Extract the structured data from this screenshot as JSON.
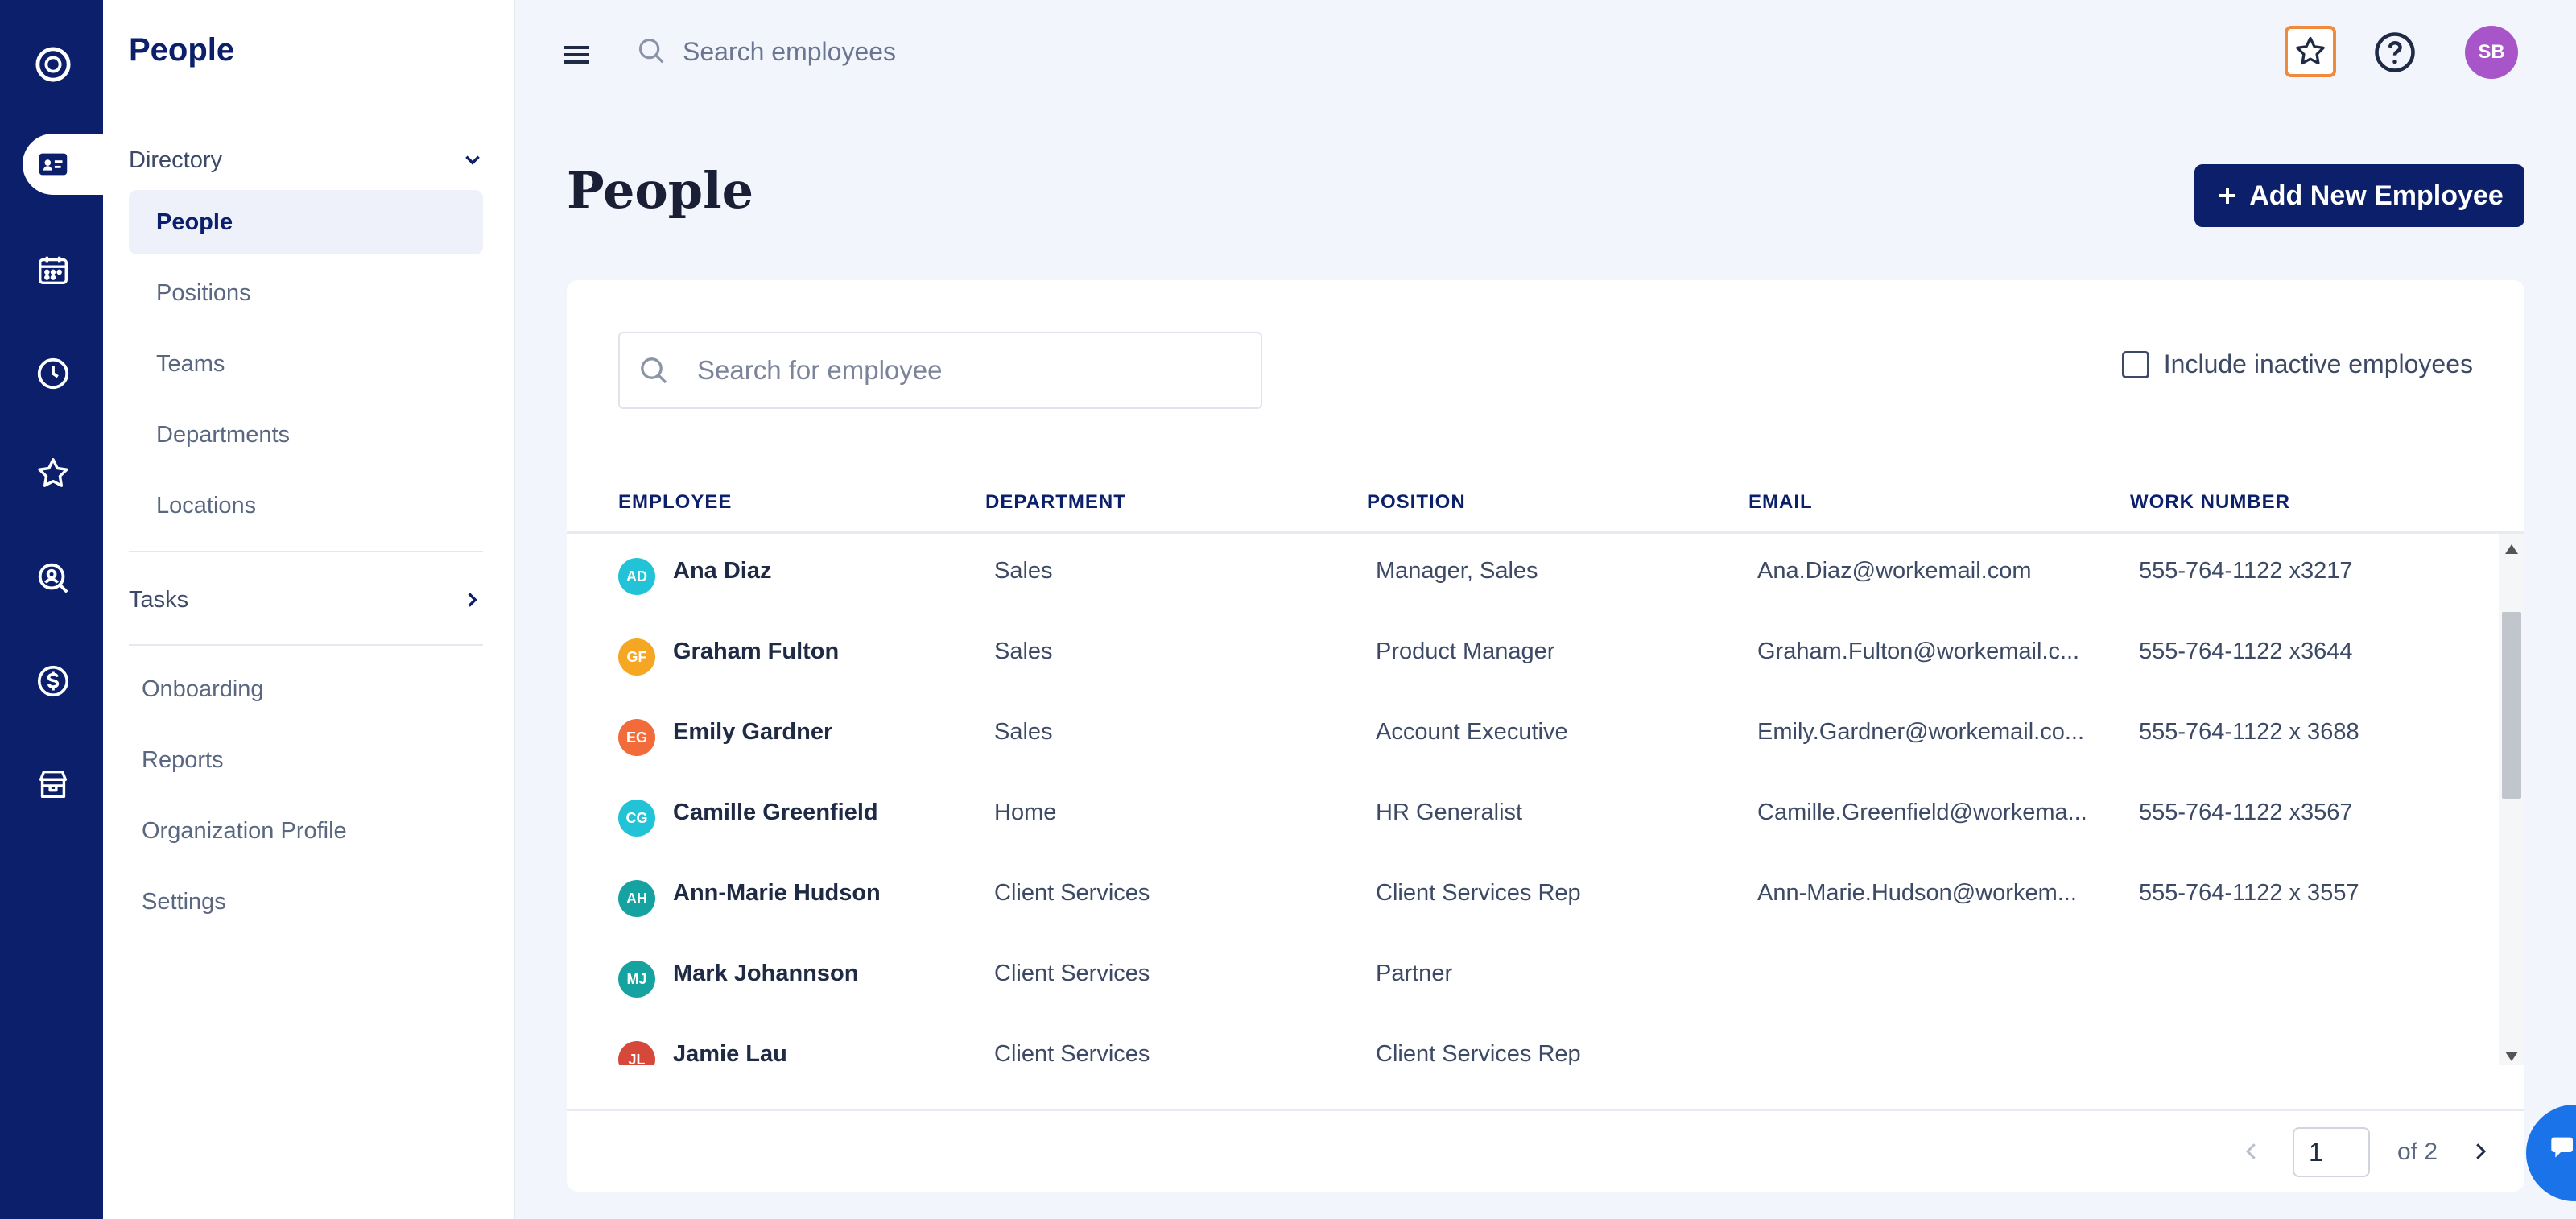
{
  "sidebar": {
    "title": "People",
    "directory_label": "Directory",
    "directory_items": [
      "People",
      "Positions",
      "Teams",
      "Departments",
      "Locations"
    ],
    "tasks_label": "Tasks",
    "other_items": [
      "Onboarding",
      "Reports",
      "Organization Profile",
      "Settings"
    ]
  },
  "topbar": {
    "search_placeholder": "Search employees",
    "avatar_initials": "SB"
  },
  "page": {
    "title": "People",
    "add_button": "Add New Employee"
  },
  "filters": {
    "search_placeholder": "Search for employee",
    "include_inactive": "Include inactive employees"
  },
  "table": {
    "headers": [
      "EMPLOYEE",
      "DEPARTMENT",
      "POSITION",
      "EMAIL",
      "WORK NUMBER"
    ],
    "rows": [
      {
        "initials": "AD",
        "color": "#22c3d6",
        "name": "Ana Diaz",
        "department": "Sales",
        "position": "Manager, Sales",
        "email": "Ana.Diaz@workemail.com",
        "phone": "555-764-1122 x3217"
      },
      {
        "initials": "GF",
        "color": "#f5a623",
        "name": "Graham Fulton",
        "department": "Sales",
        "position": "Product Manager",
        "email": "Graham.Fulton@workemail.c...",
        "phone": "555-764-1122 x3644"
      },
      {
        "initials": "EG",
        "color": "#f26b3a",
        "name": "Emily Gardner",
        "department": "Sales",
        "position": "Account Executive",
        "email": "Emily.Gardner@workemail.co...",
        "phone": "555-764-1122 x 3688"
      },
      {
        "initials": "CG",
        "color": "#22c3d6",
        "name": "Camille Greenfield",
        "department": "Home",
        "position": "HR Generalist",
        "email": "Camille.Greenfield@workema...",
        "phone": "555-764-1122 x3567"
      },
      {
        "initials": "AH",
        "color": "#17a2a2",
        "name": "Ann-Marie Hudson",
        "department": "Client Services",
        "position": "Client Services Rep",
        "email": "Ann-Marie.Hudson@workem...",
        "phone": "555-764-1122 x 3557"
      },
      {
        "initials": "MJ",
        "color": "#17a2a2",
        "name": "Mark Johannson",
        "department": "Client Services",
        "position": "Partner",
        "email": "",
        "phone": ""
      },
      {
        "initials": "JL",
        "color": "#d6483a",
        "name": "Jamie Lau",
        "department": "Client Services",
        "position": "Client Services Rep",
        "email": "",
        "phone": ""
      }
    ]
  },
  "pagination": {
    "current": "1",
    "of_label": "of 2"
  },
  "colors": {
    "brand_navy": "#0b1f6b",
    "highlight_orange": "#f08a3c",
    "avatar_purple": "#a855c9"
  }
}
